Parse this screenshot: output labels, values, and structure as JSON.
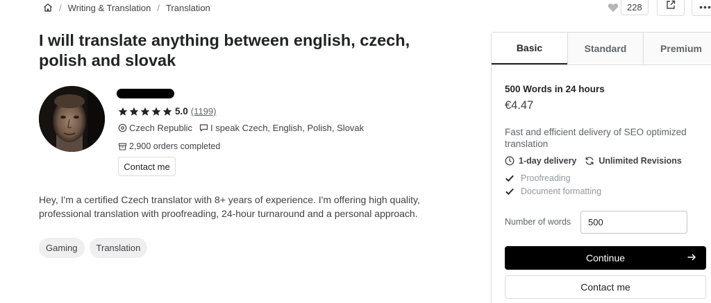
{
  "breadcrumb": {
    "items": [
      "Writing & Translation",
      "Translation"
    ],
    "separator": "/"
  },
  "actions": {
    "favorites_count": "228",
    "more_label": "•••"
  },
  "gig": {
    "title": "I will translate anything between english, czech, polish and slovak"
  },
  "seller": {
    "rating": "5.0",
    "rating_count": "(1199)",
    "location": "Czech Republic",
    "languages": "I speak Czech, English, Polish, Slovak",
    "orders": "2,900 orders completed",
    "contact_label": "Contact me"
  },
  "description": "Hey, I'm a certified Czech translator with 8+ years of experience. I'm offering high quality, professional translation with proofreading, 24-hour turnaround and a personal approach.",
  "tags": [
    "Gaming",
    "Translation"
  ],
  "package": {
    "tabs": [
      "Basic",
      "Standard",
      "Premium"
    ],
    "active_tab": "Basic",
    "title": "500 Words in 24 hours",
    "price": "€4.47",
    "description": "Fast and efficient delivery of SEO optimized translation",
    "delivery": "1-day delivery",
    "revisions": "Unlimited Revisions",
    "features": [
      "Proofreading",
      "Document formatting"
    ],
    "words_label": "Number of words",
    "words_value": "500",
    "continue_label": "Continue",
    "contact_label": "Contact me"
  },
  "colors": {
    "primary_button": "#000000",
    "text": "#222325",
    "muted": "#95979d",
    "border": "#dadbdd",
    "tag_bg": "#efeff0"
  },
  "icons": [
    "home-icon",
    "heart-icon",
    "share-icon",
    "star-icon",
    "location-pin-icon",
    "speech-bubble-icon",
    "package-icon",
    "clock-icon",
    "refresh-icon",
    "check-icon",
    "arrow-right-icon"
  ]
}
